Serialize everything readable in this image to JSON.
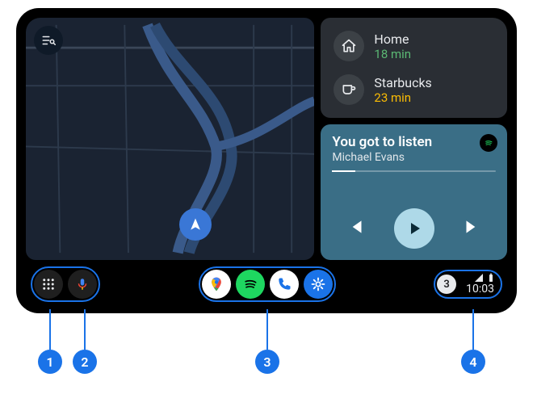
{
  "destinations": [
    {
      "name": "Home",
      "eta": "18 min",
      "etaClass": "eta-green",
      "icon": "home"
    },
    {
      "name": "Starbucks",
      "eta": "23 min",
      "etaClass": "eta-amber",
      "icon": "cafe"
    }
  ],
  "media": {
    "title": "You got to listen",
    "artist": "Michael Evans",
    "service": "spotify"
  },
  "status": {
    "notification_count": "3",
    "time": "10:03"
  },
  "callouts": {
    "c1": "1",
    "c2": "2",
    "c3": "3",
    "c4": "4"
  }
}
